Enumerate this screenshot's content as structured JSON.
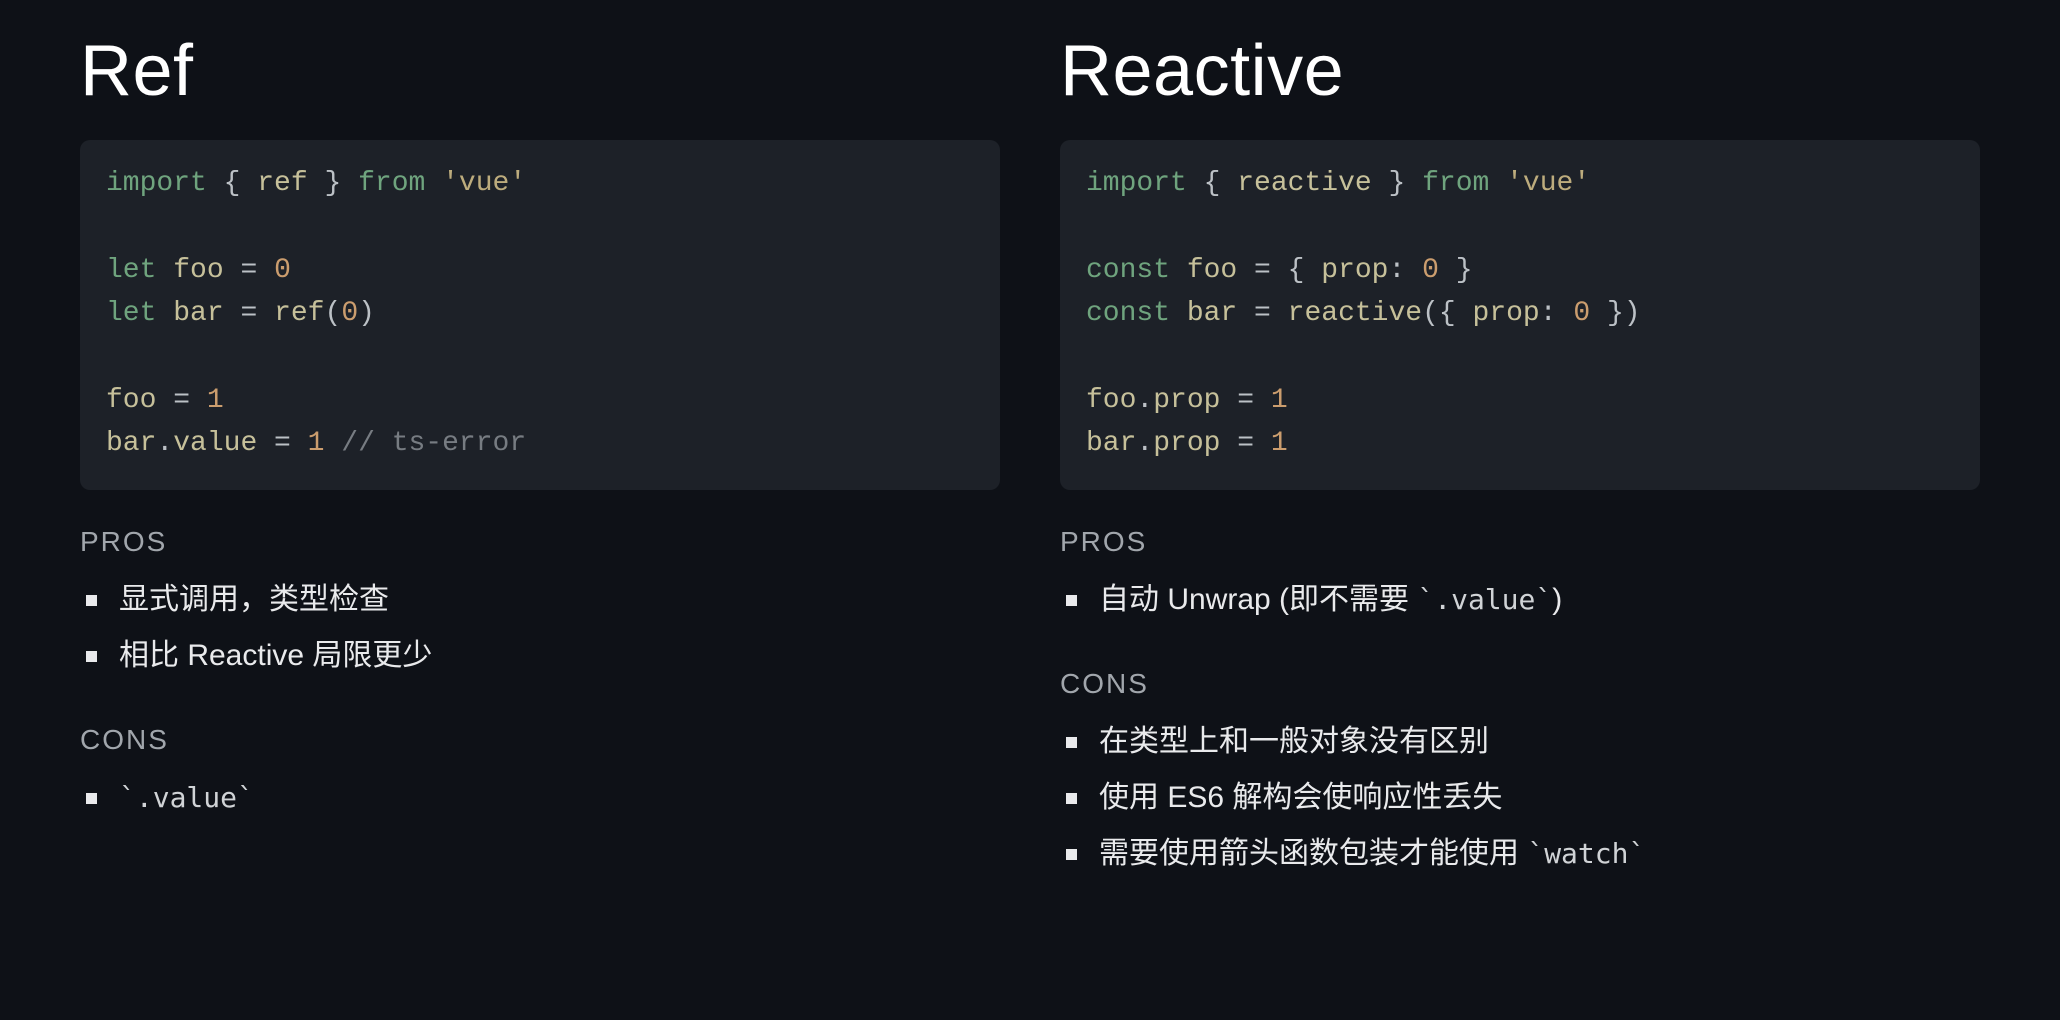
{
  "left": {
    "title": "Ref",
    "code_tokens": [
      [
        "kw",
        "import"
      ],
      [
        "p",
        " { "
      ],
      [
        "id",
        "ref"
      ],
      [
        "p",
        " } "
      ],
      [
        "kw",
        "from"
      ],
      [
        "p",
        " "
      ],
      [
        "str",
        "'vue'"
      ],
      [
        "nl"
      ],
      [
        "nl"
      ],
      [
        "kw",
        "let"
      ],
      [
        "p",
        " "
      ],
      [
        "id",
        "foo"
      ],
      [
        "p",
        " = "
      ],
      [
        "num",
        "0"
      ],
      [
        "nl"
      ],
      [
        "kw",
        "let"
      ],
      [
        "p",
        " "
      ],
      [
        "id",
        "bar"
      ],
      [
        "p",
        " = "
      ],
      [
        "id",
        "ref"
      ],
      [
        "p",
        "("
      ],
      [
        "num",
        "0"
      ],
      [
        "p",
        ")"
      ],
      [
        "nl"
      ],
      [
        "nl"
      ],
      [
        "id",
        "foo"
      ],
      [
        "p",
        " = "
      ],
      [
        "num",
        "1"
      ],
      [
        "nl"
      ],
      [
        "id",
        "bar"
      ],
      [
        "p",
        "."
      ],
      [
        "id",
        "value"
      ],
      [
        "p",
        " = "
      ],
      [
        "num",
        "1"
      ],
      [
        "p",
        " "
      ],
      [
        "cmt",
        "// ts-error"
      ]
    ],
    "pros_label": "PROS",
    "pros": [
      {
        "text": "显式调用，类型检查"
      },
      {
        "text": "相比 Reactive 局限更少"
      }
    ],
    "cons_label": "CONS",
    "cons": [
      {
        "code": "`.value`"
      }
    ]
  },
  "right": {
    "title": "Reactive",
    "code_tokens": [
      [
        "kw",
        "import"
      ],
      [
        "p",
        " { "
      ],
      [
        "id",
        "reactive"
      ],
      [
        "p",
        " } "
      ],
      [
        "kw",
        "from"
      ],
      [
        "p",
        " "
      ],
      [
        "str",
        "'vue'"
      ],
      [
        "nl"
      ],
      [
        "nl"
      ],
      [
        "kw",
        "const"
      ],
      [
        "p",
        " "
      ],
      [
        "id",
        "foo"
      ],
      [
        "p",
        " = { "
      ],
      [
        "id",
        "prop"
      ],
      [
        "p",
        ": "
      ],
      [
        "num",
        "0"
      ],
      [
        "p",
        " }"
      ],
      [
        "nl"
      ],
      [
        "kw",
        "const"
      ],
      [
        "p",
        " "
      ],
      [
        "id",
        "bar"
      ],
      [
        "p",
        " = "
      ],
      [
        "id",
        "reactive"
      ],
      [
        "p",
        "({ "
      ],
      [
        "id",
        "prop"
      ],
      [
        "p",
        ": "
      ],
      [
        "num",
        "0"
      ],
      [
        "p",
        " })"
      ],
      [
        "nl"
      ],
      [
        "nl"
      ],
      [
        "id",
        "foo"
      ],
      [
        "p",
        "."
      ],
      [
        "id",
        "prop"
      ],
      [
        "p",
        " = "
      ],
      [
        "num",
        "1"
      ],
      [
        "nl"
      ],
      [
        "id",
        "bar"
      ],
      [
        "p",
        "."
      ],
      [
        "id",
        "prop"
      ],
      [
        "p",
        " = "
      ],
      [
        "num",
        "1"
      ]
    ],
    "pros_label": "PROS",
    "pros": [
      {
        "text_pre": "自动 Unwrap (即不需要 ",
        "code": "`.value`",
        "text_post": ")"
      }
    ],
    "cons_label": "CONS",
    "cons": [
      {
        "text": "在类型上和一般对象没有区别"
      },
      {
        "text": "使用 ES6 解构会使响应性丢失"
      },
      {
        "text_pre": "需要使用箭头函数包装才能使用 ",
        "code": "`watch`"
      }
    ]
  }
}
